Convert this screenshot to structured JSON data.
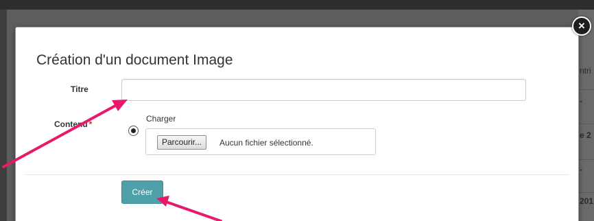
{
  "background": {
    "fragments": [
      "ntri",
      "-",
      "e 2",
      "-",
      "201"
    ]
  },
  "modal": {
    "title": "Création d'un document Image",
    "close_symbol": "×",
    "fields": {
      "titre_label": "Titre",
      "titre_value": "",
      "contenu_label": "Contenu",
      "required_marker": "*",
      "charger_label": "Charger",
      "browse_label": "Parcourir...",
      "file_status": "Aucun fichier sélectionné."
    },
    "submit_label": "Créer"
  },
  "colors": {
    "primary_button": "#4ea1aa",
    "annotation_arrow": "#e8196b",
    "required_star": "#c9302c"
  },
  "icons": [
    "close-icon",
    "radio-selected-icon",
    "annotation-arrow"
  ]
}
